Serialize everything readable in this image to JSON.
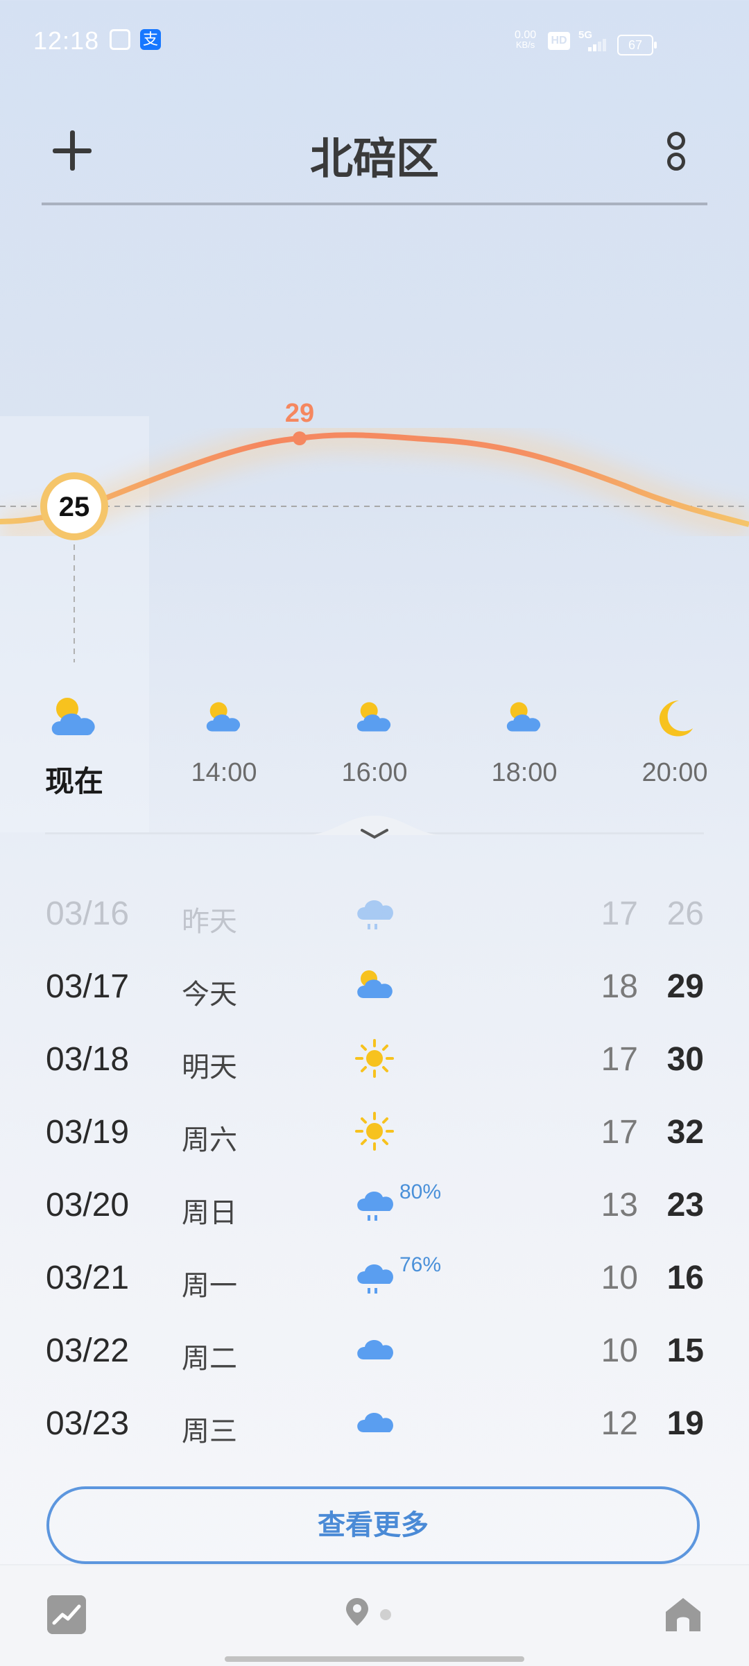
{
  "status_bar": {
    "time": "12:18",
    "net_speed": "0.00",
    "net_unit": "KB/s",
    "hd": "HD",
    "signal": "5G",
    "battery": "67"
  },
  "header": {
    "city": "北碚区"
  },
  "hourly": {
    "current_temp": "25",
    "peak_temp": "29",
    "items": [
      {
        "label": "现在",
        "icon": "partly-cloudy-icon"
      },
      {
        "label": "14:00",
        "icon": "partly-cloudy-icon"
      },
      {
        "label": "16:00",
        "icon": "partly-cloudy-icon"
      },
      {
        "label": "18:00",
        "icon": "partly-cloudy-icon"
      },
      {
        "label": "20:00",
        "icon": "moon-icon"
      }
    ]
  },
  "daily": [
    {
      "date": "03/16",
      "day": "昨天",
      "icon": "rain-cloud-icon",
      "pop": "",
      "low": "17",
      "high": "26",
      "past": true
    },
    {
      "date": "03/17",
      "day": "今天",
      "icon": "partly-cloudy-icon",
      "pop": "",
      "low": "18",
      "high": "29"
    },
    {
      "date": "03/18",
      "day": "明天",
      "icon": "sun-icon",
      "pop": "",
      "low": "17",
      "high": "30"
    },
    {
      "date": "03/19",
      "day": "周六",
      "icon": "sun-icon",
      "pop": "",
      "low": "17",
      "high": "32"
    },
    {
      "date": "03/20",
      "day": "周日",
      "icon": "rain-cloud-icon",
      "pop": "80%",
      "low": "13",
      "high": "23"
    },
    {
      "date": "03/21",
      "day": "周一",
      "icon": "rain-cloud-icon",
      "pop": "76%",
      "low": "10",
      "high": "16"
    },
    {
      "date": "03/22",
      "day": "周二",
      "icon": "cloud-icon",
      "pop": "",
      "low": "10",
      "high": "15"
    },
    {
      "date": "03/23",
      "day": "周三",
      "icon": "cloud-icon",
      "pop": "",
      "low": "12",
      "high": "19"
    }
  ],
  "more_button": "查看更多",
  "colors": {
    "accent": "#4a8ad6",
    "curve_start": "#f5c56a",
    "curve_peak": "#f5875f",
    "cloud": "#5a9ef0",
    "sun": "#f7c21e"
  }
}
